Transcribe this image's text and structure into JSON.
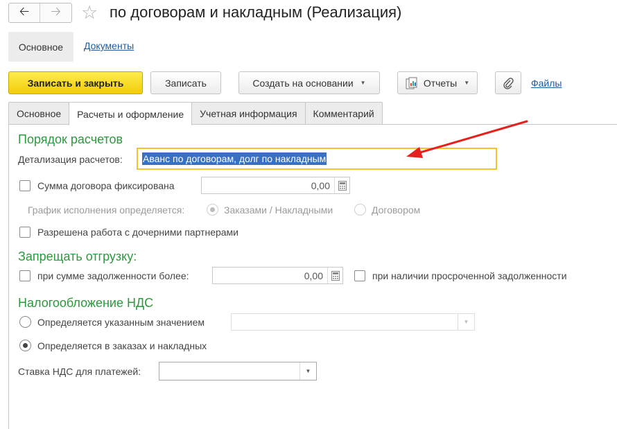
{
  "window": {
    "title": "по договорам и накладным (Реализация)"
  },
  "top_nav": {
    "active": "Основное",
    "link": "Документы"
  },
  "toolbar": {
    "save_close": "Записать и закрыть",
    "save": "Записать",
    "create_based": "Создать на основании",
    "reports": "Отчеты",
    "files": "Файлы"
  },
  "tabs": [
    {
      "label": "Основное",
      "active": false
    },
    {
      "label": "Расчеты и оформление",
      "active": true
    },
    {
      "label": "Учетная информация",
      "active": false
    },
    {
      "label": "Комментарий",
      "active": false
    }
  ],
  "settlement": {
    "heading": "Порядок расчетов",
    "detail_label": "Детализация расчетов:",
    "detail_value": "Аванс по договорам, долг по накладным",
    "fixed_amount_label": "Сумма договора фиксирована",
    "fixed_amount_checked": false,
    "fixed_amount_value": "0,00",
    "schedule_label": "График исполнения определяется:",
    "schedule_options": [
      {
        "label": "Заказами / Накладными",
        "selected": true
      },
      {
        "label": "Договором",
        "selected": false
      }
    ],
    "child_partners_label": "Разрешена работа с дочерними партнерами",
    "child_partners_checked": false
  },
  "shipment_ban": {
    "heading": "Запрещать отгрузку:",
    "debt_label": "при сумме задолженности более:",
    "debt_checked": false,
    "debt_value": "0,00",
    "overdue_label": "при наличии просроченной задолженности",
    "overdue_checked": false
  },
  "vat": {
    "heading": "Налогообложение НДС",
    "options": [
      {
        "label": "Определяется указанным значением",
        "selected": false
      },
      {
        "label": "Определяется в заказах и накладных",
        "selected": true
      }
    ],
    "specified_value": "",
    "rate_label": "Ставка НДС для платежей:",
    "rate_value": ""
  },
  "colors": {
    "accent_green": "#2a9a3c",
    "primary_button": "#f5d31c",
    "link": "#1e5a9e",
    "highlight_border": "#f3c32e",
    "selection": "#3b6fbf",
    "arrow": "#e5211d"
  },
  "icons": {
    "back": "arrow-left-icon",
    "forward": "arrow-right-icon",
    "favorite": "star-icon",
    "reports": "reports-icon",
    "attach": "paperclip-icon",
    "calculator": "calculator-icon",
    "dropdown": "chevron-down-icon"
  }
}
